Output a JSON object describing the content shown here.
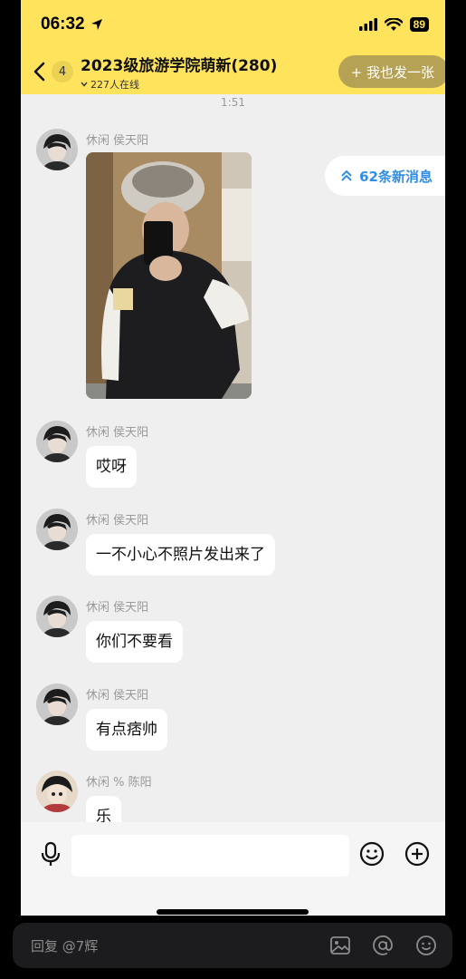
{
  "status_bar": {
    "time": "06:32",
    "battery": "89"
  },
  "header": {
    "badge_count": "4",
    "title": "2023级旅游学院萌新(280)",
    "online": "227人在线",
    "share_button": "+ 我也发一张"
  },
  "chat": {
    "timestamp": "1:51",
    "new_messages": "62条新消息",
    "messages": [
      {
        "sender": "休闲 侯天阳",
        "type": "image"
      },
      {
        "sender": "休闲 侯天阳",
        "text": "哎呀"
      },
      {
        "sender": "休闲 侯天阳",
        "text": "一不小心不照片发出来了"
      },
      {
        "sender": "休闲 侯天阳",
        "text": "你们不要看"
      },
      {
        "sender": "休闲 侯天阳",
        "text": "有点痞帅"
      },
      {
        "sender": "休闲 % 陈阳",
        "text": "乐"
      }
    ]
  },
  "reply_bar": {
    "placeholder": "回复 @7辉"
  },
  "colors": {
    "header_bg": "#ffe35c",
    "chat_bg": "#efefef",
    "link_blue": "#2f8ee8"
  }
}
